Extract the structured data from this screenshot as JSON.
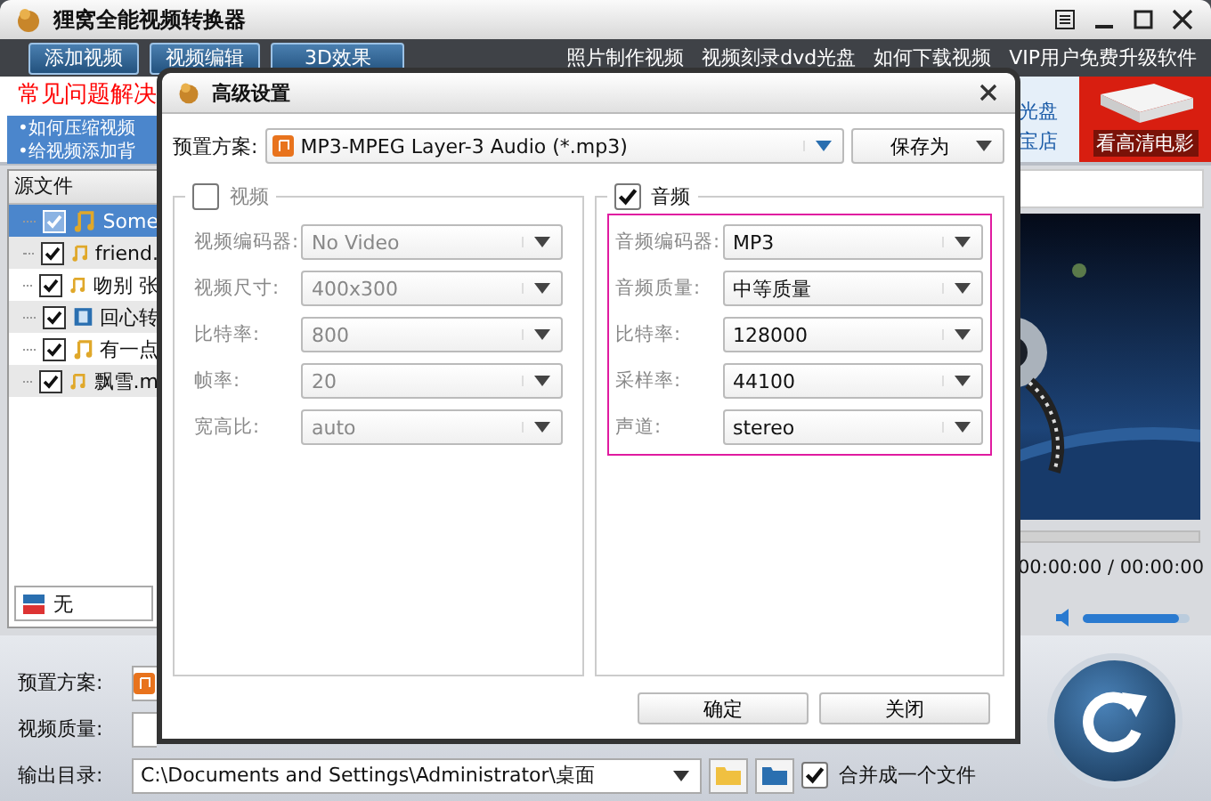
{
  "window": {
    "title": "狸窝全能视频转换器"
  },
  "toolbar": {
    "buttons": [
      "添加视频",
      "视频编辑",
      "3D效果"
    ],
    "links": [
      "照片制作视频",
      "视频刻录dvd光盘",
      "如何下载视频",
      "VIP用户免费升级软件"
    ]
  },
  "promo": {
    "heading": "常见问题解决",
    "links": [
      "•如何压缩视频",
      "•给视频添加背"
    ],
    "side_links": [
      "光盘",
      "宝店"
    ],
    "banner": "看高清电影"
  },
  "file_list": {
    "header": "源文件",
    "items": [
      {
        "name": "Some",
        "kind": "audio",
        "checked": true,
        "selected": true
      },
      {
        "name": "friend.",
        "kind": "audio",
        "checked": true,
        "selected": false
      },
      {
        "name": "吻别 张",
        "kind": "audio",
        "checked": true,
        "selected": false
      },
      {
        "name": "回心转",
        "kind": "video",
        "checked": true,
        "selected": false
      },
      {
        "name": "有一点",
        "kind": "audio",
        "checked": true,
        "selected": false
      },
      {
        "name": "飘雪.m",
        "kind": "audio",
        "checked": true,
        "selected": false
      }
    ]
  },
  "subtitle": {
    "value": "无"
  },
  "player": {
    "time": "00:00:00 / 00:00:00",
    "volume": {
      "level": 0.9
    }
  },
  "bottom": {
    "labels": [
      "预置方案:",
      "视频质量:"
    ],
    "output": {
      "label": "输出目录:",
      "value": "C:\\Documents and Settings\\Administrator\\桌面"
    },
    "merge": {
      "label": "合并成一个文件",
      "checked": true
    }
  },
  "dialog": {
    "title": "高级设置",
    "preset": {
      "label": "预置方案:",
      "value": "MP3-MPEG Layer-3 Audio (*.mp3)",
      "save": "保存为"
    },
    "video": {
      "label": "视频",
      "checked": false,
      "fields": [
        {
          "label": "视频编码器:",
          "value": "No Video"
        },
        {
          "label": "视频尺寸:",
          "value": "400x300"
        },
        {
          "label": "比特率:",
          "value": "800"
        },
        {
          "label": "帧率:",
          "value": "20"
        },
        {
          "label": "宽高比:",
          "value": "auto"
        }
      ]
    },
    "audio": {
      "label": "音频",
      "checked": true,
      "highlighted": true,
      "fields": [
        {
          "label": "音频编码器:",
          "value": "MP3"
        },
        {
          "label": "音频质量:",
          "value": "中等质量"
        },
        {
          "label": "比特率:",
          "value": "128000"
        },
        {
          "label": "采样率:",
          "value": "44100"
        },
        {
          "label": "声道:",
          "value": "stereo"
        }
      ]
    },
    "buttons": [
      "确定",
      "关闭"
    ]
  }
}
